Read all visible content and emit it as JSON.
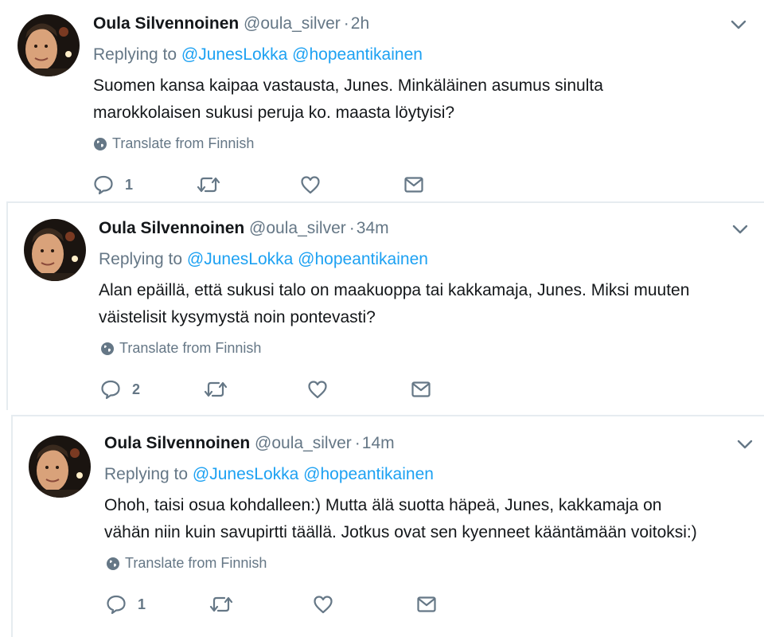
{
  "tweets": [
    {
      "author_name": "Oula Silvennoinen",
      "handle": "@oula_silver",
      "separator": "·",
      "time": "2h",
      "replying_prefix": "Replying to",
      "mentions": [
        "@JunesLokka",
        "@hopeantikainen"
      ],
      "text": "Suomen kansa kaipaa vastausta, Junes. Minkäläinen asumus sinulta\nmarokkolaisen sukusi peruja ko. maasta löytyisi?",
      "translate_label": "Translate from Finnish",
      "reply_count": "1",
      "icons": [
        "reply-icon",
        "retweet-icon",
        "like-icon",
        "direct-message-icon",
        "chevron-down-icon",
        "globe-icon"
      ]
    },
    {
      "author_name": "Oula Silvennoinen",
      "handle": "@oula_silver",
      "separator": "·",
      "time": "34m",
      "replying_prefix": "Replying to",
      "mentions": [
        "@JunesLokka",
        "@hopeantikainen"
      ],
      "text": "Alan epäillä, että sukusi talo on maakuoppa tai kakkamaja, Junes. Miksi muuten\nväistelisit kysymystä noin pontevasti?",
      "translate_label": "Translate from Finnish",
      "reply_count": "2",
      "icons": [
        "reply-icon",
        "retweet-icon",
        "like-icon",
        "direct-message-icon",
        "chevron-down-icon",
        "globe-icon"
      ]
    },
    {
      "author_name": "Oula Silvennoinen",
      "handle": "@oula_silver",
      "separator": "·",
      "time": "14m",
      "replying_prefix": "Replying to",
      "mentions": [
        "@JunesLokka",
        "@hopeantikainen"
      ],
      "text": "Ohoh, taisi osua kohdalleen:) Mutta älä suotta häpeä, Junes, kakkamaja on\nvähän niin kuin savupirtti täällä. Jotkus ovat sen kyenneet kääntämään voitoksi:)",
      "translate_label": "Translate from Finnish",
      "reply_count": "1",
      "icons": [
        "reply-icon",
        "retweet-icon",
        "like-icon",
        "direct-message-icon",
        "chevron-down-icon",
        "globe-icon"
      ]
    }
  ],
  "colors": {
    "text": "#14171a",
    "secondary": "#657786",
    "link": "#1da1f2",
    "border": "#e6ecf0"
  }
}
